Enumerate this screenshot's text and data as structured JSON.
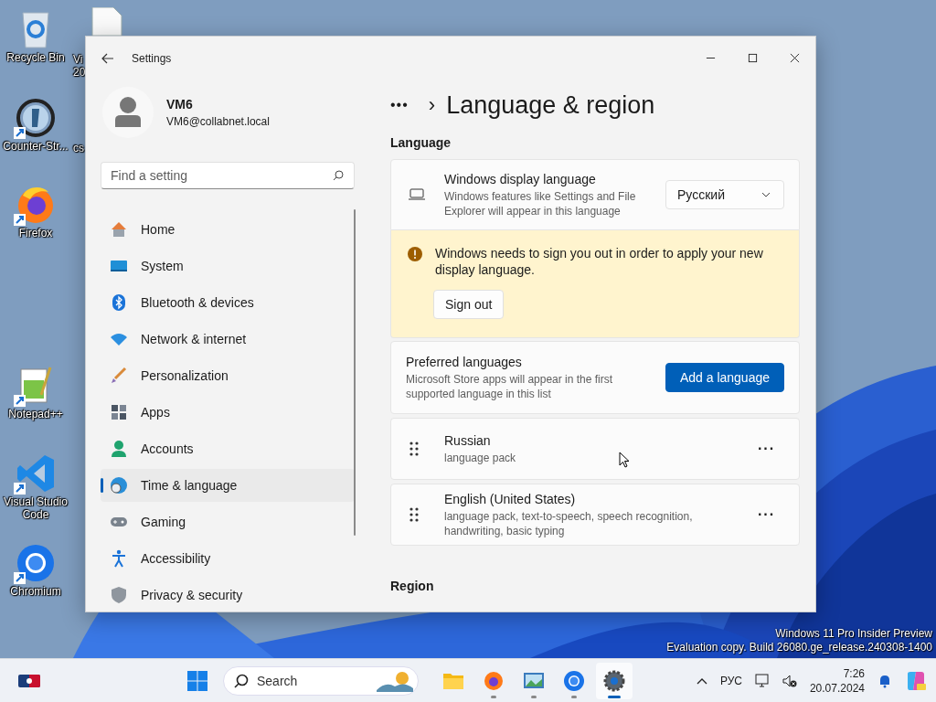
{
  "desktop": {
    "icons": [
      {
        "label": "Recycle Bin",
        "kind": "recycle",
        "shortcut": false
      },
      {
        "label": "Counter-Str...",
        "kind": "cs",
        "shortcut": true
      },
      {
        "label": "Firefox",
        "kind": "firefox",
        "shortcut": true
      },
      {
        "label": "Notepad++",
        "kind": "notepad",
        "shortcut": true
      },
      {
        "label": "Visual Studio Code",
        "kind": "vscode",
        "shortcut": true
      },
      {
        "label": "Chromium",
        "kind": "chromium",
        "shortcut": true
      }
    ],
    "partial_labels": [
      "Vi",
      "20",
      "cs"
    ],
    "watermark": [
      "Windows 11 Pro Insider Preview",
      "Evaluation copy. Build 26080.ge_release.240308-1400"
    ]
  },
  "window": {
    "title": "Settings",
    "user": {
      "name": "VM6",
      "email": "VM6@collabnet.local"
    },
    "search": {
      "placeholder": "Find a setting"
    },
    "nav": [
      {
        "label": "Home",
        "kind": "home",
        "selected": false
      },
      {
        "label": "System",
        "kind": "system",
        "selected": false
      },
      {
        "label": "Bluetooth & devices",
        "kind": "bluetooth",
        "selected": false
      },
      {
        "label": "Network & internet",
        "kind": "network",
        "selected": false
      },
      {
        "label": "Personalization",
        "kind": "brush",
        "selected": false
      },
      {
        "label": "Apps",
        "kind": "apps",
        "selected": false
      },
      {
        "label": "Accounts",
        "kind": "accounts",
        "selected": false
      },
      {
        "label": "Time & language",
        "kind": "time",
        "selected": true
      },
      {
        "label": "Gaming",
        "kind": "gaming",
        "selected": false
      },
      {
        "label": "Accessibility",
        "kind": "accessibility",
        "selected": false
      },
      {
        "label": "Privacy & security",
        "kind": "privacy",
        "selected": false
      }
    ],
    "breadcrumb": {
      "more": "•••",
      "separator": "›",
      "title": "Language & region"
    },
    "language_section": "Language",
    "display_language": {
      "title": "Windows display language",
      "description": "Windows features like Settings and File Explorer will appear in this language",
      "value": "Русский"
    },
    "warning": {
      "text": "Windows needs to sign you out in order to apply your new display language.",
      "button": "Sign out"
    },
    "preferred": {
      "title": "Preferred languages",
      "description": "Microsoft Store apps will appear in the first supported language in this list",
      "button": "Add a language"
    },
    "languages": [
      {
        "name": "Russian",
        "details": "language pack"
      },
      {
        "name": "English (United States)",
        "details": "language pack, text-to-speech, speech recognition, handwriting, basic typing"
      }
    ],
    "more_button": "···",
    "region_section": "Region"
  },
  "taskbar": {
    "search_placeholder": "Search",
    "apps": [
      {
        "kind": "explorer",
        "running": false
      },
      {
        "kind": "firefox",
        "running": true
      },
      {
        "kind": "photos",
        "running": true
      },
      {
        "kind": "chromium",
        "running": true
      },
      {
        "kind": "settings",
        "running": true
      }
    ],
    "language": "РУС",
    "time": "7:26",
    "date": "20.07.2024"
  }
}
